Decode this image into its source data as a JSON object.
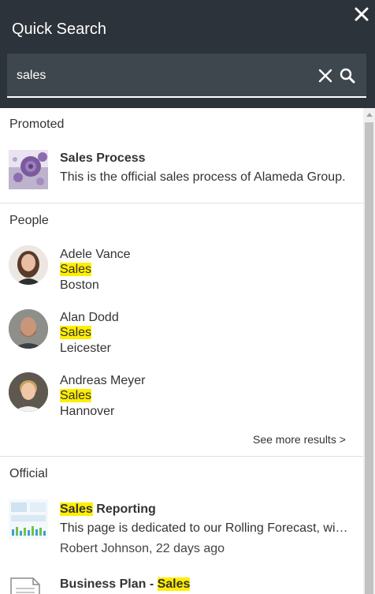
{
  "header": {
    "title": "Quick Search",
    "search_value": "sales"
  },
  "promoted": {
    "label": "Promoted",
    "item": {
      "title": "Sales Process",
      "description": "This is the official sales process of Alameda Group."
    }
  },
  "people": {
    "label": "People",
    "items": [
      {
        "name": "Adele Vance",
        "department": "Sales",
        "location": "Boston"
      },
      {
        "name": "Alan Dodd",
        "department": "Sales",
        "location": "Leicester"
      },
      {
        "name": "Andreas Meyer",
        "department": "Sales",
        "location": "Hannover"
      }
    ],
    "see_more": "See more results >"
  },
  "official": {
    "label": "Official",
    "items": [
      {
        "title_highlight": "Sales",
        "title_rest": " Reporting",
        "description": "This page is dedicated to our Rolling Forecast, wit…",
        "meta": "Robert Johnson, 22 days ago"
      },
      {
        "title_prefix": "Business Plan - ",
        "title_highlight": "Sales"
      }
    ]
  },
  "colors": {
    "header_bg": "#2c333a",
    "search_bg": "#3f474e",
    "highlight": "#ffee00"
  }
}
